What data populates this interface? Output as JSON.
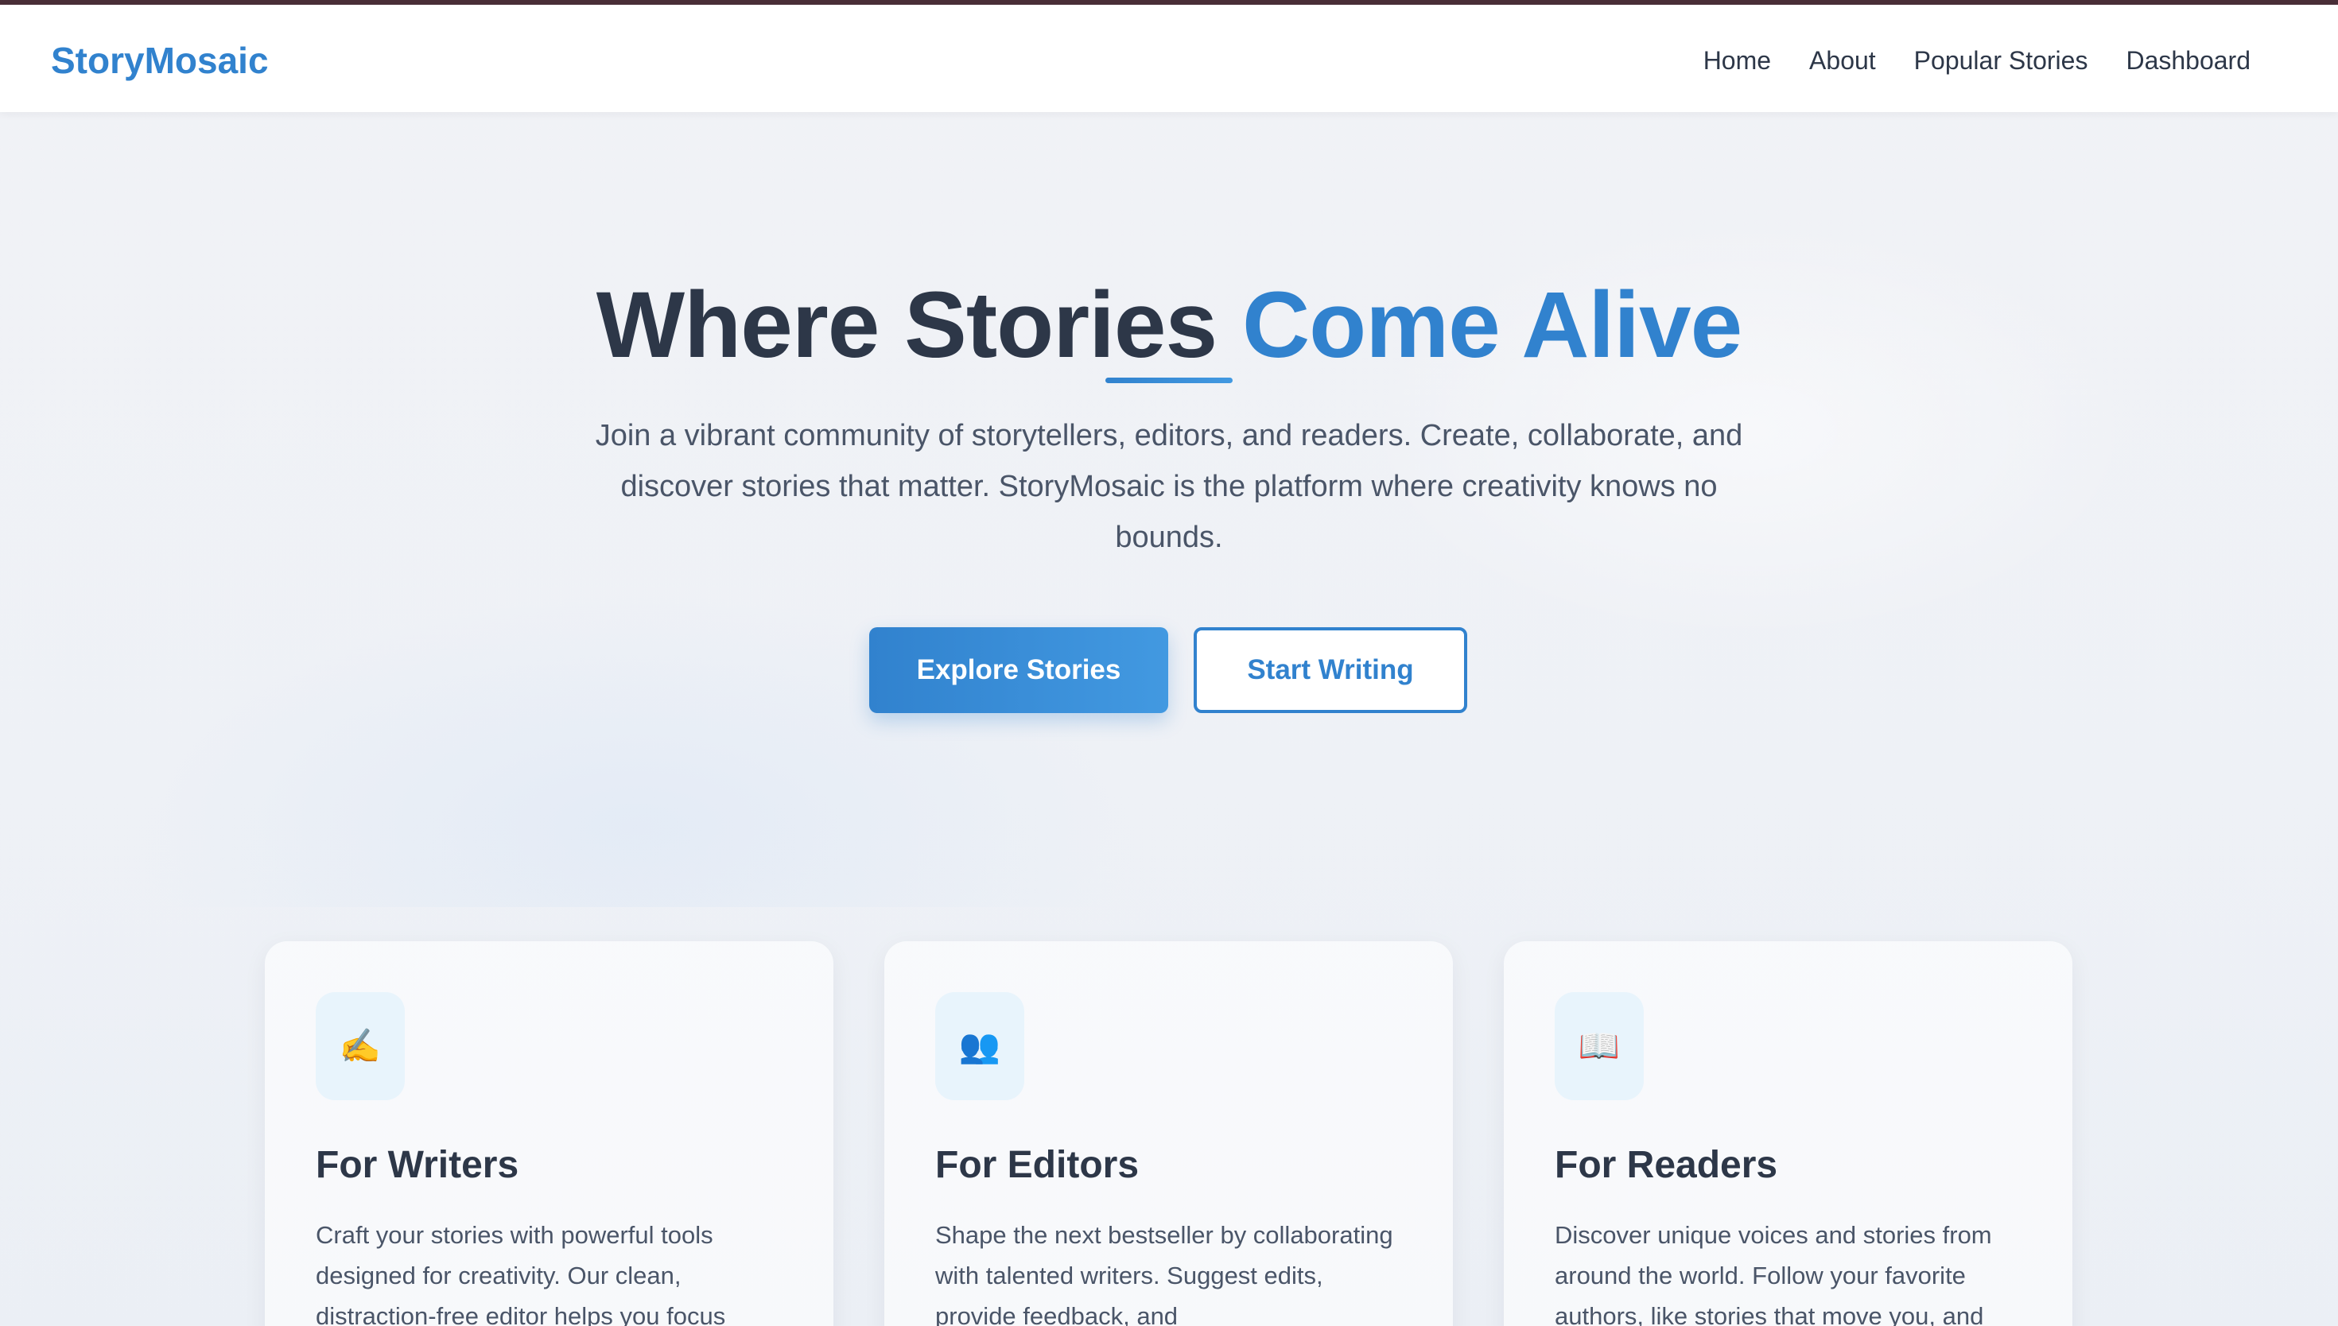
{
  "brand": "StoryMosaic",
  "nav": {
    "home": "Home",
    "about": "About",
    "popular": "Popular Stories",
    "dashboard": "Dashboard"
  },
  "hero": {
    "title_main": "Where Stories ",
    "title_accent": "Come Alive",
    "description": "Join a vibrant community of storytellers, editors, and readers. Create, collaborate, and discover stories that matter. StoryMosaic is the platform where creativity knows no bounds.",
    "primary_button": "Explore Stories",
    "secondary_button": "Start Writing"
  },
  "cards": [
    {
      "icon": "writing-hand-icon",
      "glyph": "✍️",
      "title": "For Writers",
      "text": "Craft your stories with powerful tools designed for creativity. Our clean, distraction-free editor helps you focus"
    },
    {
      "icon": "people-icon",
      "glyph": "👥",
      "title": "For Editors",
      "text": "Shape the next bestseller by collaborating with talented writers. Suggest edits, provide feedback, and"
    },
    {
      "icon": "open-book-icon",
      "glyph": "📖",
      "title": "For Readers",
      "text": "Discover unique voices and stories from around the world. Follow your favorite authors, like stories that move you, and"
    }
  ],
  "colors": {
    "accent": "#3182ce",
    "text_dark": "#2d3748",
    "text_muted": "#4a5568",
    "icon_bg": "#e8f4fc"
  }
}
